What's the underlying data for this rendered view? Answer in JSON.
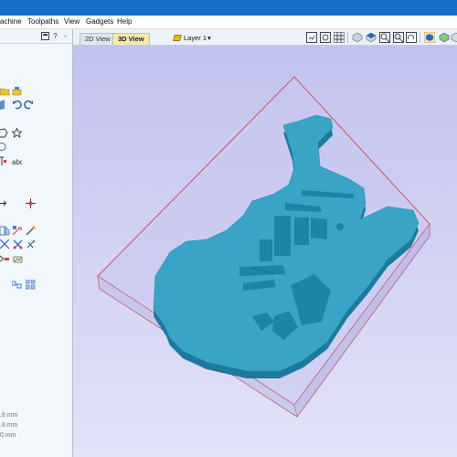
{
  "menu": [
    "achine",
    "Toolpaths",
    "View",
    "Gadgets",
    "Help"
  ],
  "panel": {
    "help_glyph": "?",
    "pin_glyph": "-",
    "coords": [
      ".8 mm",
      ".8 mm",
      "0 mm"
    ]
  },
  "tabs": {
    "view_2d": "2D View",
    "view_3d": "3D View"
  },
  "layer": {
    "label": "Layer 1",
    "arrow": "▾"
  },
  "colors": {
    "titlebar": "#1470c8",
    "body_top": "#3aa4c6",
    "body_side": "#1b7a9e",
    "block_outline": "#d04848",
    "viewport_bg": "#c8c8f0",
    "active_tab": "#f6e7a6"
  },
  "icons": {
    "left_tools": [
      "open-folder-icon",
      "open-file-icon",
      "save-icon",
      "undo-icon",
      "redo-icon",
      "polygon-icon",
      "star-icon",
      "spiral-icon",
      "node-edit-icon",
      "text-icon",
      "move-icon",
      "scale-icon",
      "mirror-icon",
      "align-icon",
      "weld-icon",
      "trim-icon",
      "offset-icon",
      "fillet-icon",
      "bitmap-icon",
      "toolpath-icon"
    ],
    "toolbar": [
      "save-view-icon",
      "zoom-extents-icon",
      "grid-icon",
      "iso-view-icon",
      "top-view-icon",
      "zoom-in-icon",
      "zoom-out-icon",
      "rotate-icon",
      "shading-icon",
      "render-icon"
    ]
  }
}
